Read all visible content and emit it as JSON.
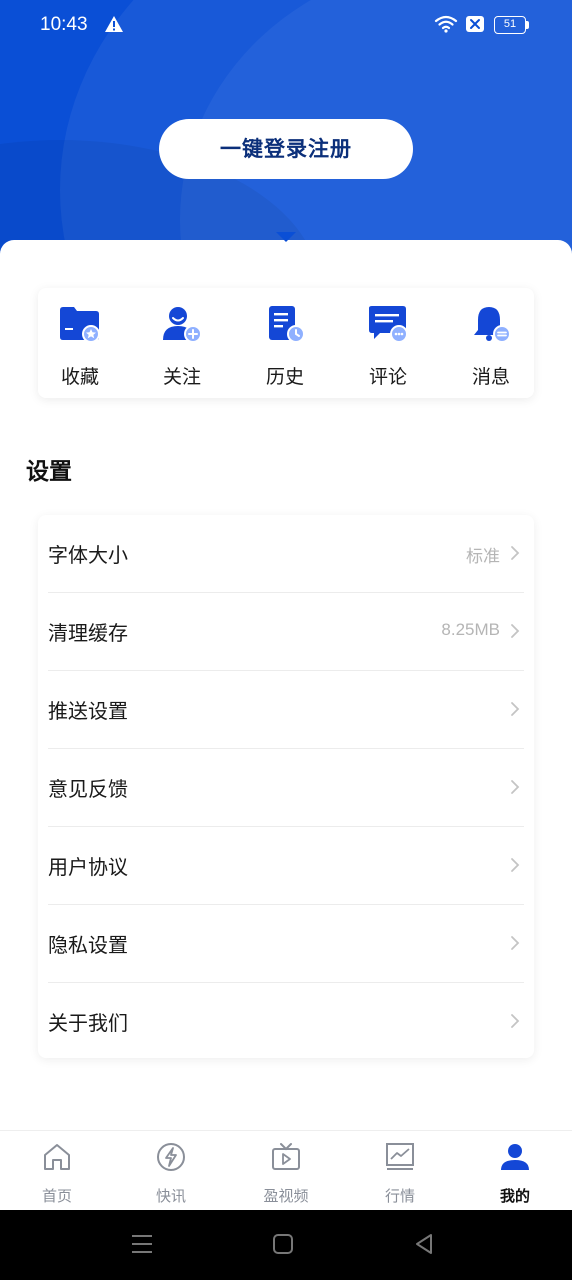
{
  "status_bar": {
    "time": "10:43",
    "battery": "51",
    "icons": [
      "warning-icon",
      "wifi-icon",
      "sim-off-icon",
      "battery-icon"
    ]
  },
  "colors": {
    "brand_blue": "#0a4fd6",
    "login_text": "#0b2f7a",
    "muted_text": "#b5b5b5",
    "tab_inactive": "#8a8f99"
  },
  "header": {
    "login_label": "一键登录注册"
  },
  "quick_actions": [
    {
      "label": "收藏",
      "icon": "folder-star-icon"
    },
    {
      "label": "关注",
      "icon": "user-add-icon"
    },
    {
      "label": "历史",
      "icon": "document-clock-icon"
    },
    {
      "label": "评论",
      "icon": "comment-icon"
    },
    {
      "label": "消息",
      "icon": "bell-icon"
    }
  ],
  "settings": {
    "title": "设置",
    "items": [
      {
        "label": "字体大小",
        "value": "标准"
      },
      {
        "label": "清理缓存",
        "value": "8.25MB"
      },
      {
        "label": "推送设置",
        "value": ""
      },
      {
        "label": "意见反馈",
        "value": ""
      },
      {
        "label": "用户协议",
        "value": ""
      },
      {
        "label": "隐私设置",
        "value": ""
      },
      {
        "label": "关于我们",
        "value": ""
      }
    ]
  },
  "tabbar": {
    "active": "我的",
    "tabs": [
      {
        "label": "首页",
        "icon": "home-icon"
      },
      {
        "label": "快讯",
        "icon": "flash-icon"
      },
      {
        "label": "盈视频",
        "icon": "tv-play-icon"
      },
      {
        "label": "行情",
        "icon": "chart-icon"
      },
      {
        "label": "我的",
        "icon": "user-icon"
      }
    ]
  },
  "system_nav": [
    "menu-icon",
    "home-square-icon",
    "back-triangle-icon"
  ]
}
